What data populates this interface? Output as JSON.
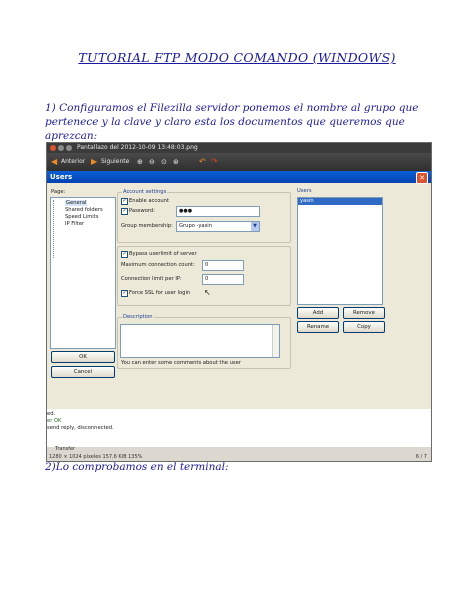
{
  "title": "TUTORIAL FTP MODO COMANDO (WINDOWS)",
  "step1": {
    "line1": "1) Configuramos el Filezilla servidor ponemos el nombre al grupo  que",
    "line2": "pertenece  y la clave y claro esta los documentos que queremos que",
    "line3": "aprezcan:"
  },
  "viewer": {
    "window_title": "Pantallazo del 2012-10-09 13:48:03.png",
    "back_label": "Anterior",
    "next_label": "Siguiente",
    "status_info": "1280 × 1024 píxeles  157,6 KiB  135%",
    "page_counter": "6 / 7"
  },
  "dialog": {
    "title": "Users",
    "close_glyph": "✕",
    "page_label": "Page:",
    "tree": [
      "General",
      "Shared folders",
      "Speed Limits",
      "IP Filter"
    ],
    "account_settings_label": "Account settings",
    "enable_account_label": "Enable account",
    "password_label": "Password:",
    "password_value": "●●●",
    "group_membership_label": "Group membership:",
    "group_value": "Grupo -yasin",
    "bypass_label": "Bypass userlimit of server",
    "max_conn_label": "Maximum connection count:",
    "max_conn_value": "0",
    "conn_limit_label": "Connection limit per IP:",
    "conn_limit_value": "0",
    "force_ssl_label": "Force SSL for user login",
    "description_label": "Description",
    "description_hint": "You can enter some comments about the user",
    "users_label": "Users",
    "users_list": [
      "yasin"
    ],
    "add_button": "Add",
    "remove_button": "Remove",
    "rename_button": "Rename",
    "copy_button": "Copy",
    "ok_button": "OK",
    "cancel_button": "Cancel"
  },
  "log": {
    "lines": [
      "ed.",
      "er OK",
      "send reply, disconnected."
    ],
    "transfer_label": "Transfer"
  },
  "step2": {
    "text": "2)Lo comprobamos en el terminal:"
  },
  "colors": {
    "heading": "#1a1a9c",
    "titlebar": "#0a5fd8",
    "selection": "#316ac5"
  }
}
